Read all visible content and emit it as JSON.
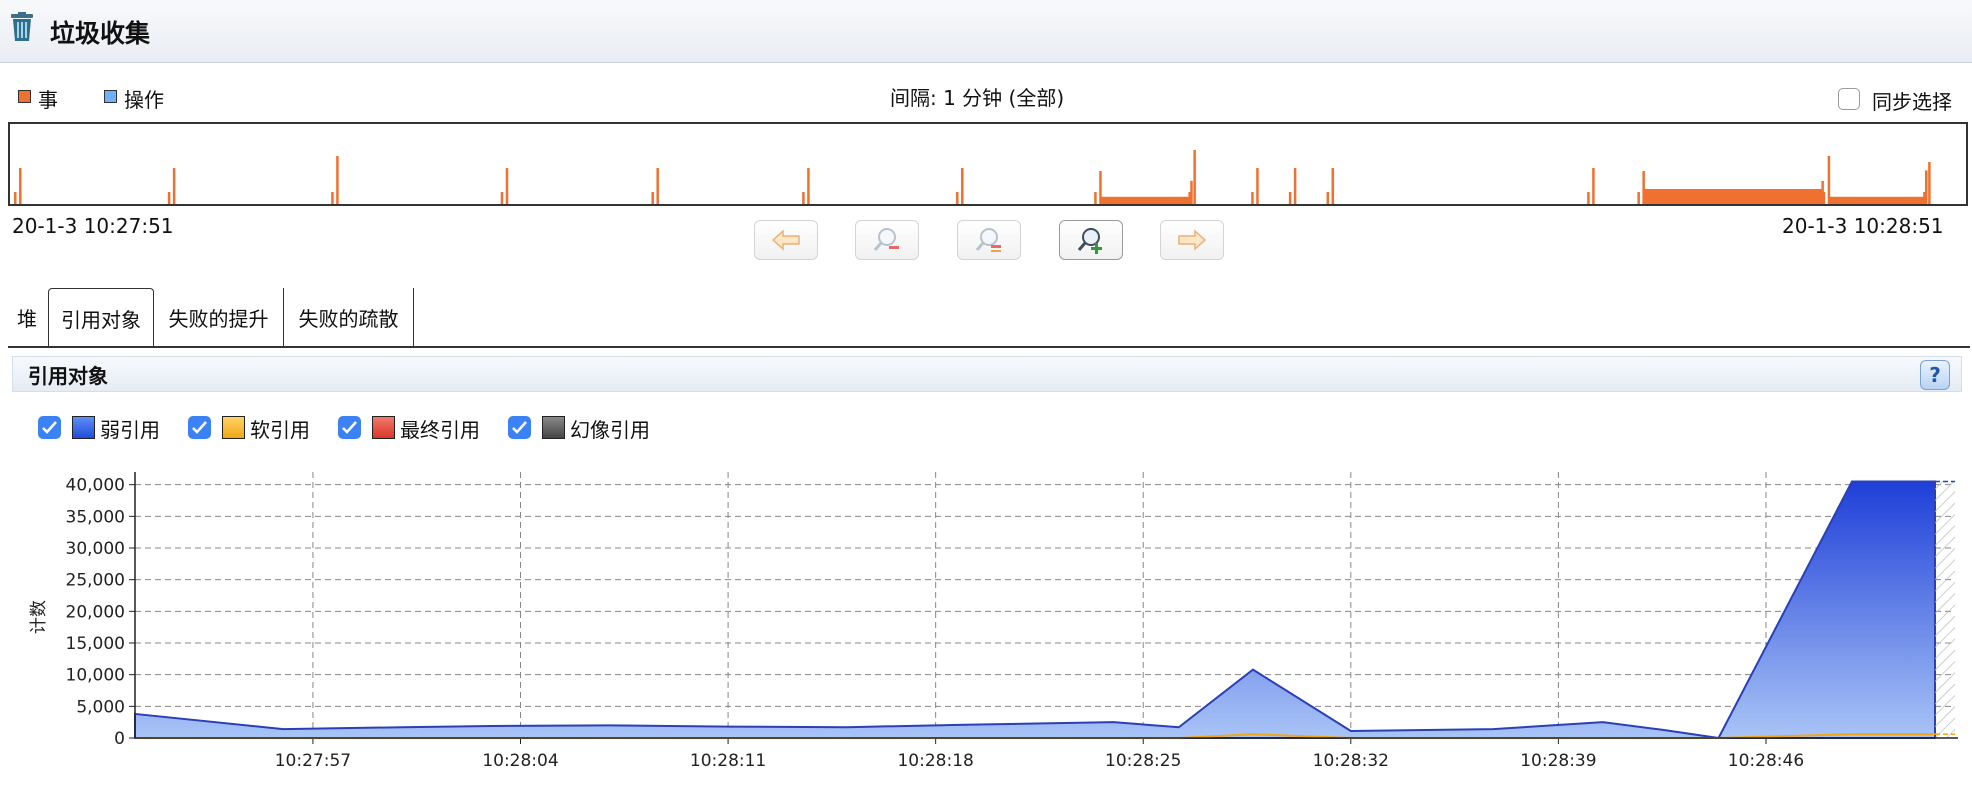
{
  "window": {
    "title": "垃圾收集",
    "icon": "trash-icon"
  },
  "overview": {
    "legend": [
      {
        "label": "事",
        "color": "#f07030"
      },
      {
        "label": "操作",
        "color": "#6fb0ff"
      }
    ],
    "interval_label": "间隔: 1 分钟 (全部)",
    "sync_label": "同步选择",
    "sync_checked": false,
    "start_time": "20-1-3 10:27:51",
    "end_time": "20-1-3 10:28:51",
    "nav_buttons": [
      "arrow-left-icon",
      "zoom-out-icon",
      "zoom-reset-icon",
      "zoom-in-icon",
      "arrow-right-icon"
    ]
  },
  "tabs": [
    {
      "label": "堆",
      "active": false
    },
    {
      "label": "引用对象",
      "active": true
    },
    {
      "label": "失败的提升",
      "active": false
    },
    {
      "label": "失败的疏散",
      "active": false
    }
  ],
  "panel": {
    "title": "引用对象",
    "help_label": "?",
    "series_toggles": [
      {
        "label": "弱引用",
        "checked": true,
        "color": "#3d6ef0"
      },
      {
        "label": "软引用",
        "checked": true,
        "color": "#f5b82a"
      },
      {
        "label": "最终引用",
        "checked": true,
        "color": "#e84a3a"
      },
      {
        "label": "幻像引用",
        "checked": true,
        "color": "#555555"
      }
    ]
  },
  "chart_data": {
    "type": "area",
    "ylabel": "计数",
    "ylim": [
      0,
      42000
    ],
    "yticks": [
      "40,000",
      "35,000",
      "30,000",
      "25,000",
      "20,000",
      "15,000",
      "10,000",
      "5,000",
      "0"
    ],
    "xticks": [
      "10:27:57",
      "10:28:04",
      "10:28:11",
      "10:28:18",
      "10:28:25",
      "10:28:32",
      "10:28:39",
      "10:28:46"
    ],
    "grid": true,
    "x_seconds": [
      0,
      5,
      9,
      12,
      16,
      20,
      24,
      28,
      33,
      35.2,
      37.7,
      41,
      45.8,
      49.5,
      51.5,
      53.4,
      57.9,
      60.7
    ],
    "series": [
      {
        "name": "弱引用",
        "values": [
          3800,
          1400,
          1700,
          1900,
          2000,
          1800,
          1700,
          2100,
          2500,
          1700,
          10800,
          1100,
          1400,
          2500,
          1300,
          0,
          40500,
          40500
        ]
      },
      {
        "name": "软引用",
        "values": [
          0,
          0,
          0,
          0,
          0,
          0,
          0,
          0,
          0,
          0,
          600,
          0,
          0,
          0,
          0,
          0,
          600,
          600
        ]
      },
      {
        "name": "最终引用",
        "values": [
          0,
          0,
          0,
          0,
          0,
          0,
          0,
          0,
          0,
          0,
          0,
          0,
          0,
          0,
          0,
          0,
          0,
          0
        ]
      },
      {
        "name": "幻像引用",
        "values": [
          0,
          0,
          0,
          0,
          0,
          0,
          0,
          0,
          0,
          0,
          0,
          0,
          0,
          0,
          0,
          0,
          0,
          0
        ]
      }
    ],
    "events": [
      {
        "t": 0.2,
        "h": 0.6
      },
      {
        "t": 5.1,
        "h": 0.6
      },
      {
        "t": 10.3,
        "h": 0.8
      },
      {
        "t": 15.7,
        "h": 0.6
      },
      {
        "t": 20.5,
        "h": 0.6
      },
      {
        "t": 25.3,
        "h": 0.6
      },
      {
        "t": 30.2,
        "h": 0.6
      },
      {
        "t": 34.6,
        "h": 0.55,
        "end": 37.5
      },
      {
        "t": 37.6,
        "h": 0.9
      },
      {
        "t": 39.6,
        "h": 0.6
      },
      {
        "t": 40.8,
        "h": 0.6
      },
      {
        "t": 42.0,
        "h": 0.6
      },
      {
        "t": 50.3,
        "h": 0.6
      },
      {
        "t": 51.9,
        "h": 0.55,
        "end": 57.6,
        "fill": 0.25
      },
      {
        "t": 57.8,
        "h": 0.8,
        "end": 60.9
      },
      {
        "t": 61.0,
        "h": 0.7
      }
    ]
  }
}
